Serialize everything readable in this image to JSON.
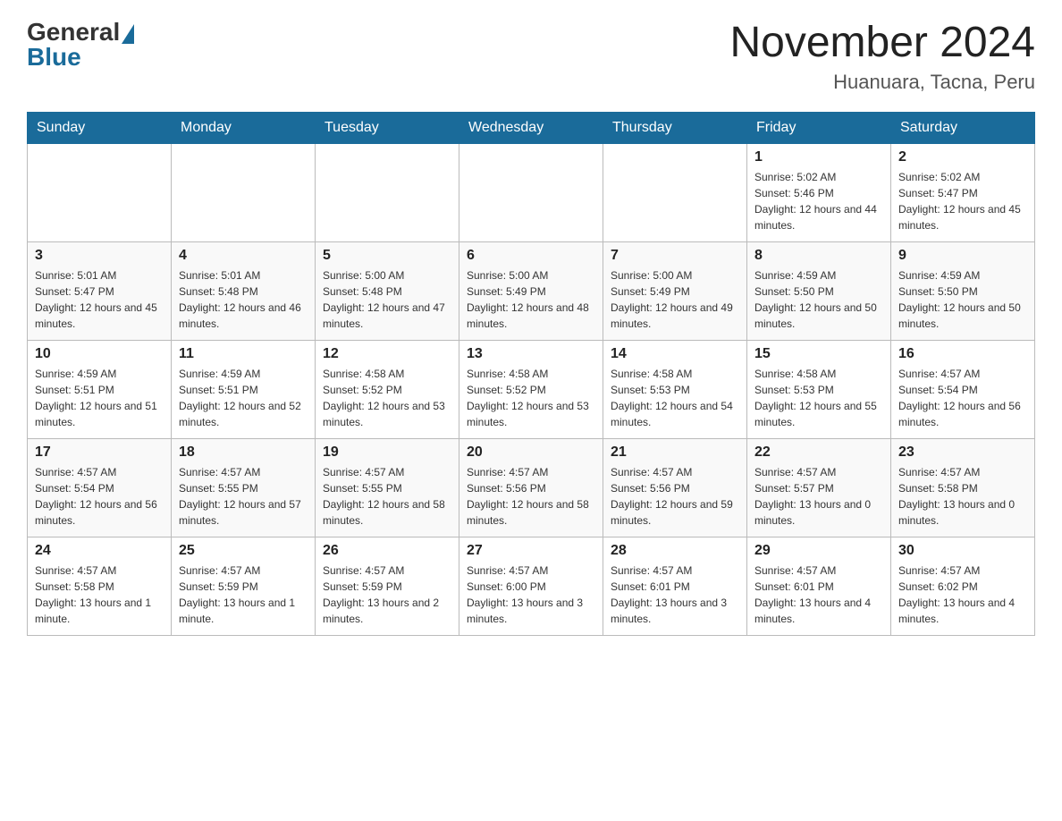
{
  "header": {
    "logo_general": "General",
    "logo_blue": "Blue",
    "month_year": "November 2024",
    "location": "Huanuara, Tacna, Peru"
  },
  "days_of_week": [
    "Sunday",
    "Monday",
    "Tuesday",
    "Wednesday",
    "Thursday",
    "Friday",
    "Saturday"
  ],
  "weeks": [
    [
      {
        "day": "",
        "sunrise": "",
        "sunset": "",
        "daylight": ""
      },
      {
        "day": "",
        "sunrise": "",
        "sunset": "",
        "daylight": ""
      },
      {
        "day": "",
        "sunrise": "",
        "sunset": "",
        "daylight": ""
      },
      {
        "day": "",
        "sunrise": "",
        "sunset": "",
        "daylight": ""
      },
      {
        "day": "",
        "sunrise": "",
        "sunset": "",
        "daylight": ""
      },
      {
        "day": "1",
        "sunrise": "Sunrise: 5:02 AM",
        "sunset": "Sunset: 5:46 PM",
        "daylight": "Daylight: 12 hours and 44 minutes."
      },
      {
        "day": "2",
        "sunrise": "Sunrise: 5:02 AM",
        "sunset": "Sunset: 5:47 PM",
        "daylight": "Daylight: 12 hours and 45 minutes."
      }
    ],
    [
      {
        "day": "3",
        "sunrise": "Sunrise: 5:01 AM",
        "sunset": "Sunset: 5:47 PM",
        "daylight": "Daylight: 12 hours and 45 minutes."
      },
      {
        "day": "4",
        "sunrise": "Sunrise: 5:01 AM",
        "sunset": "Sunset: 5:48 PM",
        "daylight": "Daylight: 12 hours and 46 minutes."
      },
      {
        "day": "5",
        "sunrise": "Sunrise: 5:00 AM",
        "sunset": "Sunset: 5:48 PM",
        "daylight": "Daylight: 12 hours and 47 minutes."
      },
      {
        "day": "6",
        "sunrise": "Sunrise: 5:00 AM",
        "sunset": "Sunset: 5:49 PM",
        "daylight": "Daylight: 12 hours and 48 minutes."
      },
      {
        "day": "7",
        "sunrise": "Sunrise: 5:00 AM",
        "sunset": "Sunset: 5:49 PM",
        "daylight": "Daylight: 12 hours and 49 minutes."
      },
      {
        "day": "8",
        "sunrise": "Sunrise: 4:59 AM",
        "sunset": "Sunset: 5:50 PM",
        "daylight": "Daylight: 12 hours and 50 minutes."
      },
      {
        "day": "9",
        "sunrise": "Sunrise: 4:59 AM",
        "sunset": "Sunset: 5:50 PM",
        "daylight": "Daylight: 12 hours and 50 minutes."
      }
    ],
    [
      {
        "day": "10",
        "sunrise": "Sunrise: 4:59 AM",
        "sunset": "Sunset: 5:51 PM",
        "daylight": "Daylight: 12 hours and 51 minutes."
      },
      {
        "day": "11",
        "sunrise": "Sunrise: 4:59 AM",
        "sunset": "Sunset: 5:51 PM",
        "daylight": "Daylight: 12 hours and 52 minutes."
      },
      {
        "day": "12",
        "sunrise": "Sunrise: 4:58 AM",
        "sunset": "Sunset: 5:52 PM",
        "daylight": "Daylight: 12 hours and 53 minutes."
      },
      {
        "day": "13",
        "sunrise": "Sunrise: 4:58 AM",
        "sunset": "Sunset: 5:52 PM",
        "daylight": "Daylight: 12 hours and 53 minutes."
      },
      {
        "day": "14",
        "sunrise": "Sunrise: 4:58 AM",
        "sunset": "Sunset: 5:53 PM",
        "daylight": "Daylight: 12 hours and 54 minutes."
      },
      {
        "day": "15",
        "sunrise": "Sunrise: 4:58 AM",
        "sunset": "Sunset: 5:53 PM",
        "daylight": "Daylight: 12 hours and 55 minutes."
      },
      {
        "day": "16",
        "sunrise": "Sunrise: 4:57 AM",
        "sunset": "Sunset: 5:54 PM",
        "daylight": "Daylight: 12 hours and 56 minutes."
      }
    ],
    [
      {
        "day": "17",
        "sunrise": "Sunrise: 4:57 AM",
        "sunset": "Sunset: 5:54 PM",
        "daylight": "Daylight: 12 hours and 56 minutes."
      },
      {
        "day": "18",
        "sunrise": "Sunrise: 4:57 AM",
        "sunset": "Sunset: 5:55 PM",
        "daylight": "Daylight: 12 hours and 57 minutes."
      },
      {
        "day": "19",
        "sunrise": "Sunrise: 4:57 AM",
        "sunset": "Sunset: 5:55 PM",
        "daylight": "Daylight: 12 hours and 58 minutes."
      },
      {
        "day": "20",
        "sunrise": "Sunrise: 4:57 AM",
        "sunset": "Sunset: 5:56 PM",
        "daylight": "Daylight: 12 hours and 58 minutes."
      },
      {
        "day": "21",
        "sunrise": "Sunrise: 4:57 AM",
        "sunset": "Sunset: 5:56 PM",
        "daylight": "Daylight: 12 hours and 59 minutes."
      },
      {
        "day": "22",
        "sunrise": "Sunrise: 4:57 AM",
        "sunset": "Sunset: 5:57 PM",
        "daylight": "Daylight: 13 hours and 0 minutes."
      },
      {
        "day": "23",
        "sunrise": "Sunrise: 4:57 AM",
        "sunset": "Sunset: 5:58 PM",
        "daylight": "Daylight: 13 hours and 0 minutes."
      }
    ],
    [
      {
        "day": "24",
        "sunrise": "Sunrise: 4:57 AM",
        "sunset": "Sunset: 5:58 PM",
        "daylight": "Daylight: 13 hours and 1 minute."
      },
      {
        "day": "25",
        "sunrise": "Sunrise: 4:57 AM",
        "sunset": "Sunset: 5:59 PM",
        "daylight": "Daylight: 13 hours and 1 minute."
      },
      {
        "day": "26",
        "sunrise": "Sunrise: 4:57 AM",
        "sunset": "Sunset: 5:59 PM",
        "daylight": "Daylight: 13 hours and 2 minutes."
      },
      {
        "day": "27",
        "sunrise": "Sunrise: 4:57 AM",
        "sunset": "Sunset: 6:00 PM",
        "daylight": "Daylight: 13 hours and 3 minutes."
      },
      {
        "day": "28",
        "sunrise": "Sunrise: 4:57 AM",
        "sunset": "Sunset: 6:01 PM",
        "daylight": "Daylight: 13 hours and 3 minutes."
      },
      {
        "day": "29",
        "sunrise": "Sunrise: 4:57 AM",
        "sunset": "Sunset: 6:01 PM",
        "daylight": "Daylight: 13 hours and 4 minutes."
      },
      {
        "day": "30",
        "sunrise": "Sunrise: 4:57 AM",
        "sunset": "Sunset: 6:02 PM",
        "daylight": "Daylight: 13 hours and 4 minutes."
      }
    ]
  ]
}
